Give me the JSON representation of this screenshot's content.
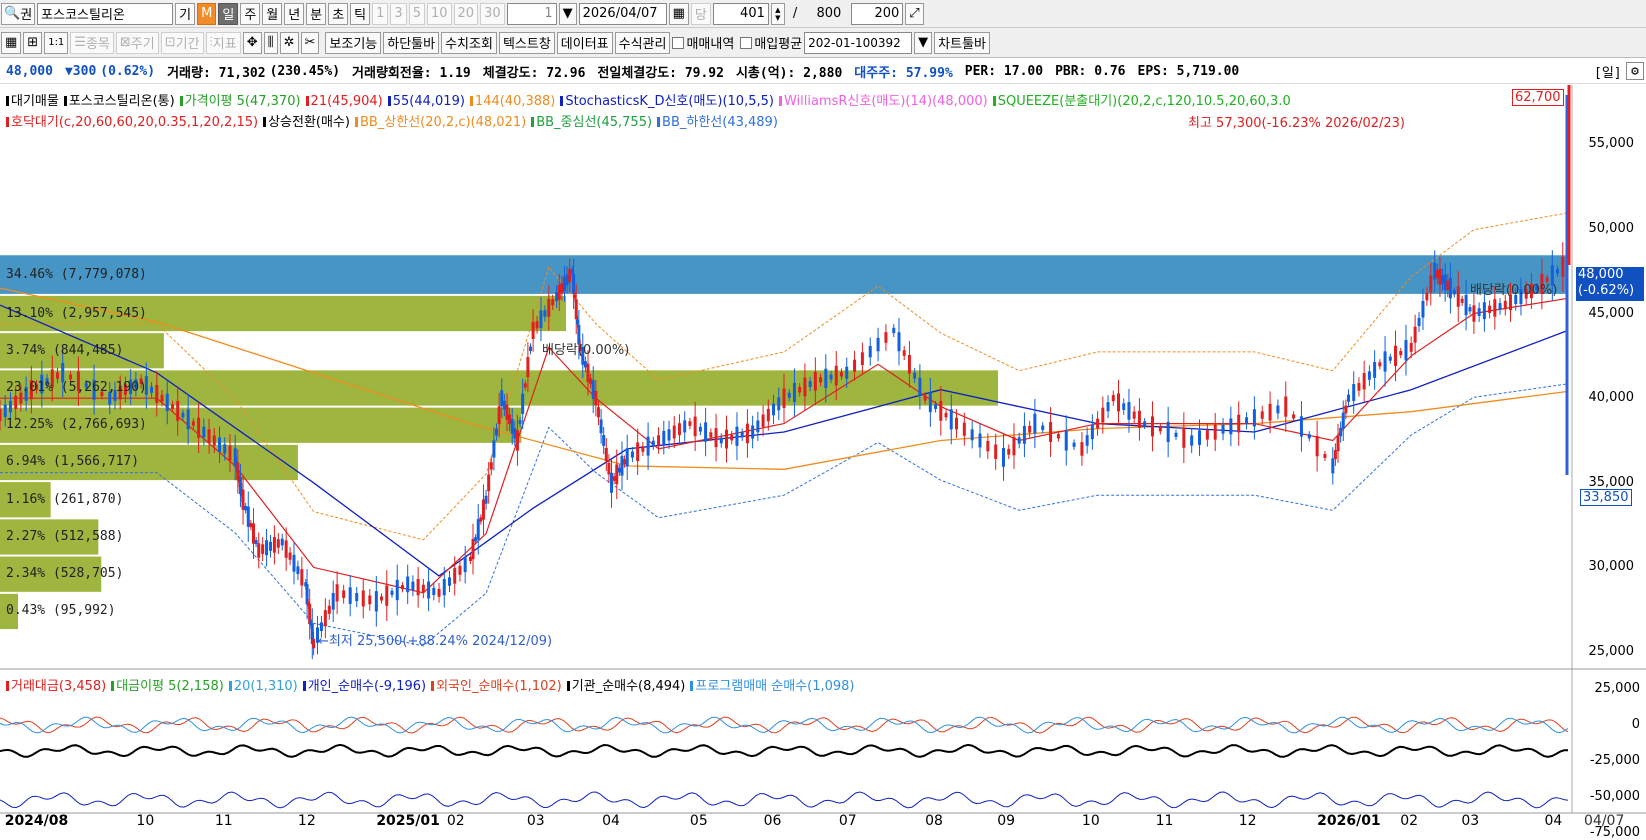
{
  "toolbar1": {
    "stock_name": "포스코스틸리온",
    "btn_gi": "기",
    "btn_m": "M",
    "periods": [
      "일",
      "주",
      "월",
      "년",
      "분",
      "초",
      "틱"
    ],
    "nums": [
      "1",
      "3",
      "5",
      "10",
      "20",
      "30"
    ],
    "count_value": "1",
    "date_value": "2026/04/07",
    "dang": "당",
    "view_count": "401",
    "slash": "/",
    "total": "800",
    "zoom": "200"
  },
  "toolbar2": {
    "disabled": [
      "종목",
      "주기",
      "기간",
      "지표"
    ],
    "buttons": [
      "보조기능",
      "하단툴바",
      "수치조회",
      "텍스트창",
      "데이터표",
      "수식관리"
    ],
    "check1": "매매내역",
    "check2": "매입평균",
    "account": "202-01-100392",
    "chart_toolbar": "차트툴바"
  },
  "info": {
    "price": "48,000",
    "change": "▼300",
    "pct": "(0.62%)",
    "volume": "거래량: 71,302",
    "vol_pct": "(230.45%)",
    "turnover": "거래량회전율: 1.19",
    "strength": "체결강도: 72.96",
    "prev_strength": "전일체결강도: 79.92",
    "mcap": "시총(억): 2,880",
    "major": "대주주: 57.99%",
    "per": "PER: 17.00",
    "pbr": "PBR: 0.76",
    "eps": "EPS: 5,719.00",
    "period_tag": "[일]"
  },
  "legend1": {
    "items": [
      {
        "text": "대기매물",
        "color": "#000000"
      },
      {
        "text": "포스코스틸리온(통)",
        "color": "#000000"
      },
      {
        "text": "가격이평 5(47,370)",
        "color": "#28a028"
      },
      {
        "text": "21(45,904)",
        "color": "#e02020"
      },
      {
        "text": "55(44,019)",
        "color": "#1020c0"
      },
      {
        "text": "144(40,388)",
        "color": "#f08c1e"
      },
      {
        "text": "StochasticsK_D신호(매도)(10,5,5)",
        "color": "#1020c0"
      },
      {
        "text": "WilliamsR신호(매도)(14)(48,000)",
        "color": "#f060e0"
      },
      {
        "text": "SQUEEZE(분출대기)(20,2,c,120,10.5,20,60,3.0",
        "color": "#20b020"
      }
    ]
  },
  "legend2": {
    "items": [
      {
        "text": "호닥대기(c,20,60,60,20,0.35,1,20,2,15)",
        "color": "#e02020"
      },
      {
        "text": "상승전환(매수)",
        "color": "#000000"
      },
      {
        "text": "BB_상한선(20,2,c)(48,021)",
        "color": "#f08c1e"
      },
      {
        "text": "BB_중심선(45,755)",
        "color": "#20a040"
      },
      {
        "text": "BB_하한선(43,489)",
        "color": "#3070e0"
      }
    ]
  },
  "legend3": {
    "items": [
      {
        "text": "거래대금(3,458)",
        "color": "#e02020"
      },
      {
        "text": "대금이평 5(2,158)",
        "color": "#28a028"
      },
      {
        "text": "20(1,310)",
        "color": "#30a0e0"
      },
      {
        "text": "개인_순매수(-9,196)",
        "color": "#1020c0"
      },
      {
        "text": "외국인_순매수(1,102)",
        "color": "#e04020"
      },
      {
        "text": "기관_순매수(8,494)",
        "color": "#000000"
      },
      {
        "text": "프로그램매매 순매수(1,098)",
        "color": "#3090e0"
      }
    ]
  },
  "annotations": {
    "high": "최고 57,300(-16.23% 2026/02/23)",
    "low": "←최저 25,500(+88.24% 2024/12/09)",
    "dividend1": "배당락(0.00%)",
    "dividend2": "배당락(0.00%)",
    "box_high": "62,700",
    "box_last": "48,000",
    "box_last_pct": "(-0.62%)",
    "box_low": "33,850"
  },
  "volume_profile": [
    {
      "label": "34.46% (7,779,078)",
      "price_low": 46100,
      "price_high": 48500,
      "pct": 100,
      "highlight": true
    },
    {
      "label": "13.10% (2,957,545)",
      "price_low": 43900,
      "price_high": 46100,
      "pct": 38
    },
    {
      "label": "3.74% (844,485)",
      "price_low": 41700,
      "price_high": 43900,
      "pct": 11
    },
    {
      "label": "23.01% (5,262,190)",
      "price_low": 39500,
      "price_high": 41700,
      "pct": 67
    },
    {
      "label": "12.25% (2,766,693)",
      "price_low": 37300,
      "price_high": 39500,
      "pct": 35
    },
    {
      "label": "6.94% (1,566,717)",
      "price_low": 35100,
      "price_high": 37300,
      "pct": 20
    },
    {
      "label": "1.16% (261,870)",
      "price_low": 32900,
      "price_high": 35100,
      "pct": 3.4
    },
    {
      "label": "2.27% (512,588)",
      "price_low": 30700,
      "price_high": 32900,
      "pct": 6.6
    },
    {
      "label": "2.34% (528,705)",
      "price_low": 28500,
      "price_high": 30700,
      "pct": 6.8
    },
    {
      "label": "0.43% (95,992)",
      "price_low": 26300,
      "price_high": 28500,
      "pct": 1.2
    }
  ],
  "price_axis": {
    "ticks": [
      "55,000",
      "50,000",
      "45,000",
      "40,000",
      "35,000",
      "30,000",
      "25,000"
    ]
  },
  "sub_axis": {
    "ticks": [
      "25,000",
      "0",
      "-25,000",
      "-50,000",
      "-75,000"
    ]
  },
  "x_axis": {
    "labels": [
      {
        "t": "2024/08",
        "bold": true,
        "pos": 0.003
      },
      {
        "t": "10",
        "pos": 0.087
      },
      {
        "t": "11",
        "pos": 0.137
      },
      {
        "t": "12",
        "pos": 0.19
      },
      {
        "t": "2025/01",
        "bold": true,
        "pos": 0.24
      },
      {
        "t": "02",
        "pos": 0.285
      },
      {
        "t": "03",
        "pos": 0.336
      },
      {
        "t": "04",
        "pos": 0.384
      },
      {
        "t": "05",
        "pos": 0.44
      },
      {
        "t": "06",
        "pos": 0.487
      },
      {
        "t": "07",
        "pos": 0.535
      },
      {
        "t": "08",
        "pos": 0.59
      },
      {
        "t": "09",
        "pos": 0.636
      },
      {
        "t": "10",
        "pos": 0.69
      },
      {
        "t": "11",
        "pos": 0.737
      },
      {
        "t": "12",
        "pos": 0.79
      },
      {
        "t": "2026/01",
        "bold": true,
        "pos": 0.84
      },
      {
        "t": "02",
        "pos": 0.893
      },
      {
        "t": "03",
        "pos": 0.932
      },
      {
        "t": "04",
        "pos": 0.985
      }
    ],
    "current": "04/07"
  },
  "chart_data": {
    "type": "candlestick",
    "ylim": [
      24000,
      58500
    ],
    "price_series": [
      {
        "t": 0,
        "p": 39000
      },
      {
        "t": 0.02,
        "p": 40500
      },
      {
        "t": 0.04,
        "p": 41500
      },
      {
        "t": 0.07,
        "p": 40000
      },
      {
        "t": 0.09,
        "p": 41000
      },
      {
        "t": 0.11,
        "p": 39500
      },
      {
        "t": 0.13,
        "p": 38000
      },
      {
        "t": 0.15,
        "p": 36500
      },
      {
        "t": 0.155,
        "p": 34000
      },
      {
        "t": 0.165,
        "p": 31000
      },
      {
        "t": 0.18,
        "p": 31500
      },
      {
        "t": 0.195,
        "p": 29000
      },
      {
        "t": 0.2,
        "p": 25500
      },
      {
        "t": 0.215,
        "p": 28500
      },
      {
        "t": 0.24,
        "p": 28000
      },
      {
        "t": 0.26,
        "p": 29000
      },
      {
        "t": 0.28,
        "p": 28500
      },
      {
        "t": 0.3,
        "p": 30500
      },
      {
        "t": 0.31,
        "p": 34000
      },
      {
        "t": 0.32,
        "p": 40000
      },
      {
        "t": 0.33,
        "p": 37500
      },
      {
        "t": 0.34,
        "p": 44000
      },
      {
        "t": 0.355,
        "p": 46000
      },
      {
        "t": 0.365,
        "p": 47500
      },
      {
        "t": 0.37,
        "p": 43000
      },
      {
        "t": 0.38,
        "p": 40000
      },
      {
        "t": 0.39,
        "p": 35000
      },
      {
        "t": 0.4,
        "p": 36500
      },
      {
        "t": 0.42,
        "p": 37500
      },
      {
        "t": 0.44,
        "p": 38500
      },
      {
        "t": 0.46,
        "p": 37500
      },
      {
        "t": 0.48,
        "p": 38000
      },
      {
        "t": 0.5,
        "p": 40000
      },
      {
        "t": 0.52,
        "p": 41000
      },
      {
        "t": 0.54,
        "p": 41500
      },
      {
        "t": 0.57,
        "p": 44000
      },
      {
        "t": 0.59,
        "p": 40000
      },
      {
        "t": 0.61,
        "p": 38500
      },
      {
        "t": 0.64,
        "p": 36500
      },
      {
        "t": 0.66,
        "p": 38500
      },
      {
        "t": 0.69,
        "p": 37000
      },
      {
        "t": 0.71,
        "p": 40000
      },
      {
        "t": 0.73,
        "p": 38500
      },
      {
        "t": 0.76,
        "p": 37500
      },
      {
        "t": 0.79,
        "p": 38500
      },
      {
        "t": 0.82,
        "p": 39500
      },
      {
        "t": 0.85,
        "p": 36000
      },
      {
        "t": 0.86,
        "p": 40000
      },
      {
        "t": 0.88,
        "p": 42000
      },
      {
        "t": 0.9,
        "p": 43000
      },
      {
        "t": 0.915,
        "p": 47500
      },
      {
        "t": 0.925,
        "p": 46500
      },
      {
        "t": 0.94,
        "p": 45000
      },
      {
        "t": 0.96,
        "p": 45500
      },
      {
        "t": 0.98,
        "p": 46500
      },
      {
        "t": 1,
        "p": 48000
      }
    ],
    "ma144": [
      {
        "t": 0,
        "p": 46500
      },
      {
        "t": 0.1,
        "p": 44500
      },
      {
        "t": 0.2,
        "p": 41500
      },
      {
        "t": 0.3,
        "p": 38500
      },
      {
        "t": 0.4,
        "p": 36000
      },
      {
        "t": 0.5,
        "p": 35800
      },
      {
        "t": 0.6,
        "p": 37500
      },
      {
        "t": 0.7,
        "p": 38200
      },
      {
        "t": 0.8,
        "p": 38500
      },
      {
        "t": 0.9,
        "p": 39200
      },
      {
        "t": 1,
        "p": 40400
      }
    ],
    "ma55": [
      {
        "t": 0,
        "p": 45500
      },
      {
        "t": 0.1,
        "p": 41500
      },
      {
        "t": 0.2,
        "p": 35000
      },
      {
        "t": 0.28,
        "p": 29500
      },
      {
        "t": 0.34,
        "p": 33500
      },
      {
        "t": 0.4,
        "p": 37000
      },
      {
        "t": 0.5,
        "p": 38000
      },
      {
        "t": 0.6,
        "p": 40500
      },
      {
        "t": 0.7,
        "p": 38500
      },
      {
        "t": 0.8,
        "p": 38000
      },
      {
        "t": 0.9,
        "p": 40500
      },
      {
        "t": 1,
        "p": 44000
      }
    ],
    "ma21": [
      {
        "t": 0,
        "p": 40000
      },
      {
        "t": 0.1,
        "p": 40000
      },
      {
        "t": 0.15,
        "p": 36000
      },
      {
        "t": 0.2,
        "p": 30000
      },
      {
        "t": 0.27,
        "p": 28500
      },
      {
        "t": 0.31,
        "p": 32000
      },
      {
        "t": 0.35,
        "p": 43000
      },
      {
        "t": 0.38,
        "p": 40000
      },
      {
        "t": 0.42,
        "p": 37000
      },
      {
        "t": 0.5,
        "p": 38500
      },
      {
        "t": 0.56,
        "p": 42000
      },
      {
        "t": 0.6,
        "p": 39500
      },
      {
        "t": 0.65,
        "p": 37500
      },
      {
        "t": 0.7,
        "p": 38500
      },
      {
        "t": 0.8,
        "p": 38500
      },
      {
        "t": 0.85,
        "p": 37500
      },
      {
        "t": 0.9,
        "p": 42500
      },
      {
        "t": 0.94,
        "p": 45000
      },
      {
        "t": 1,
        "p": 45900
      }
    ]
  }
}
